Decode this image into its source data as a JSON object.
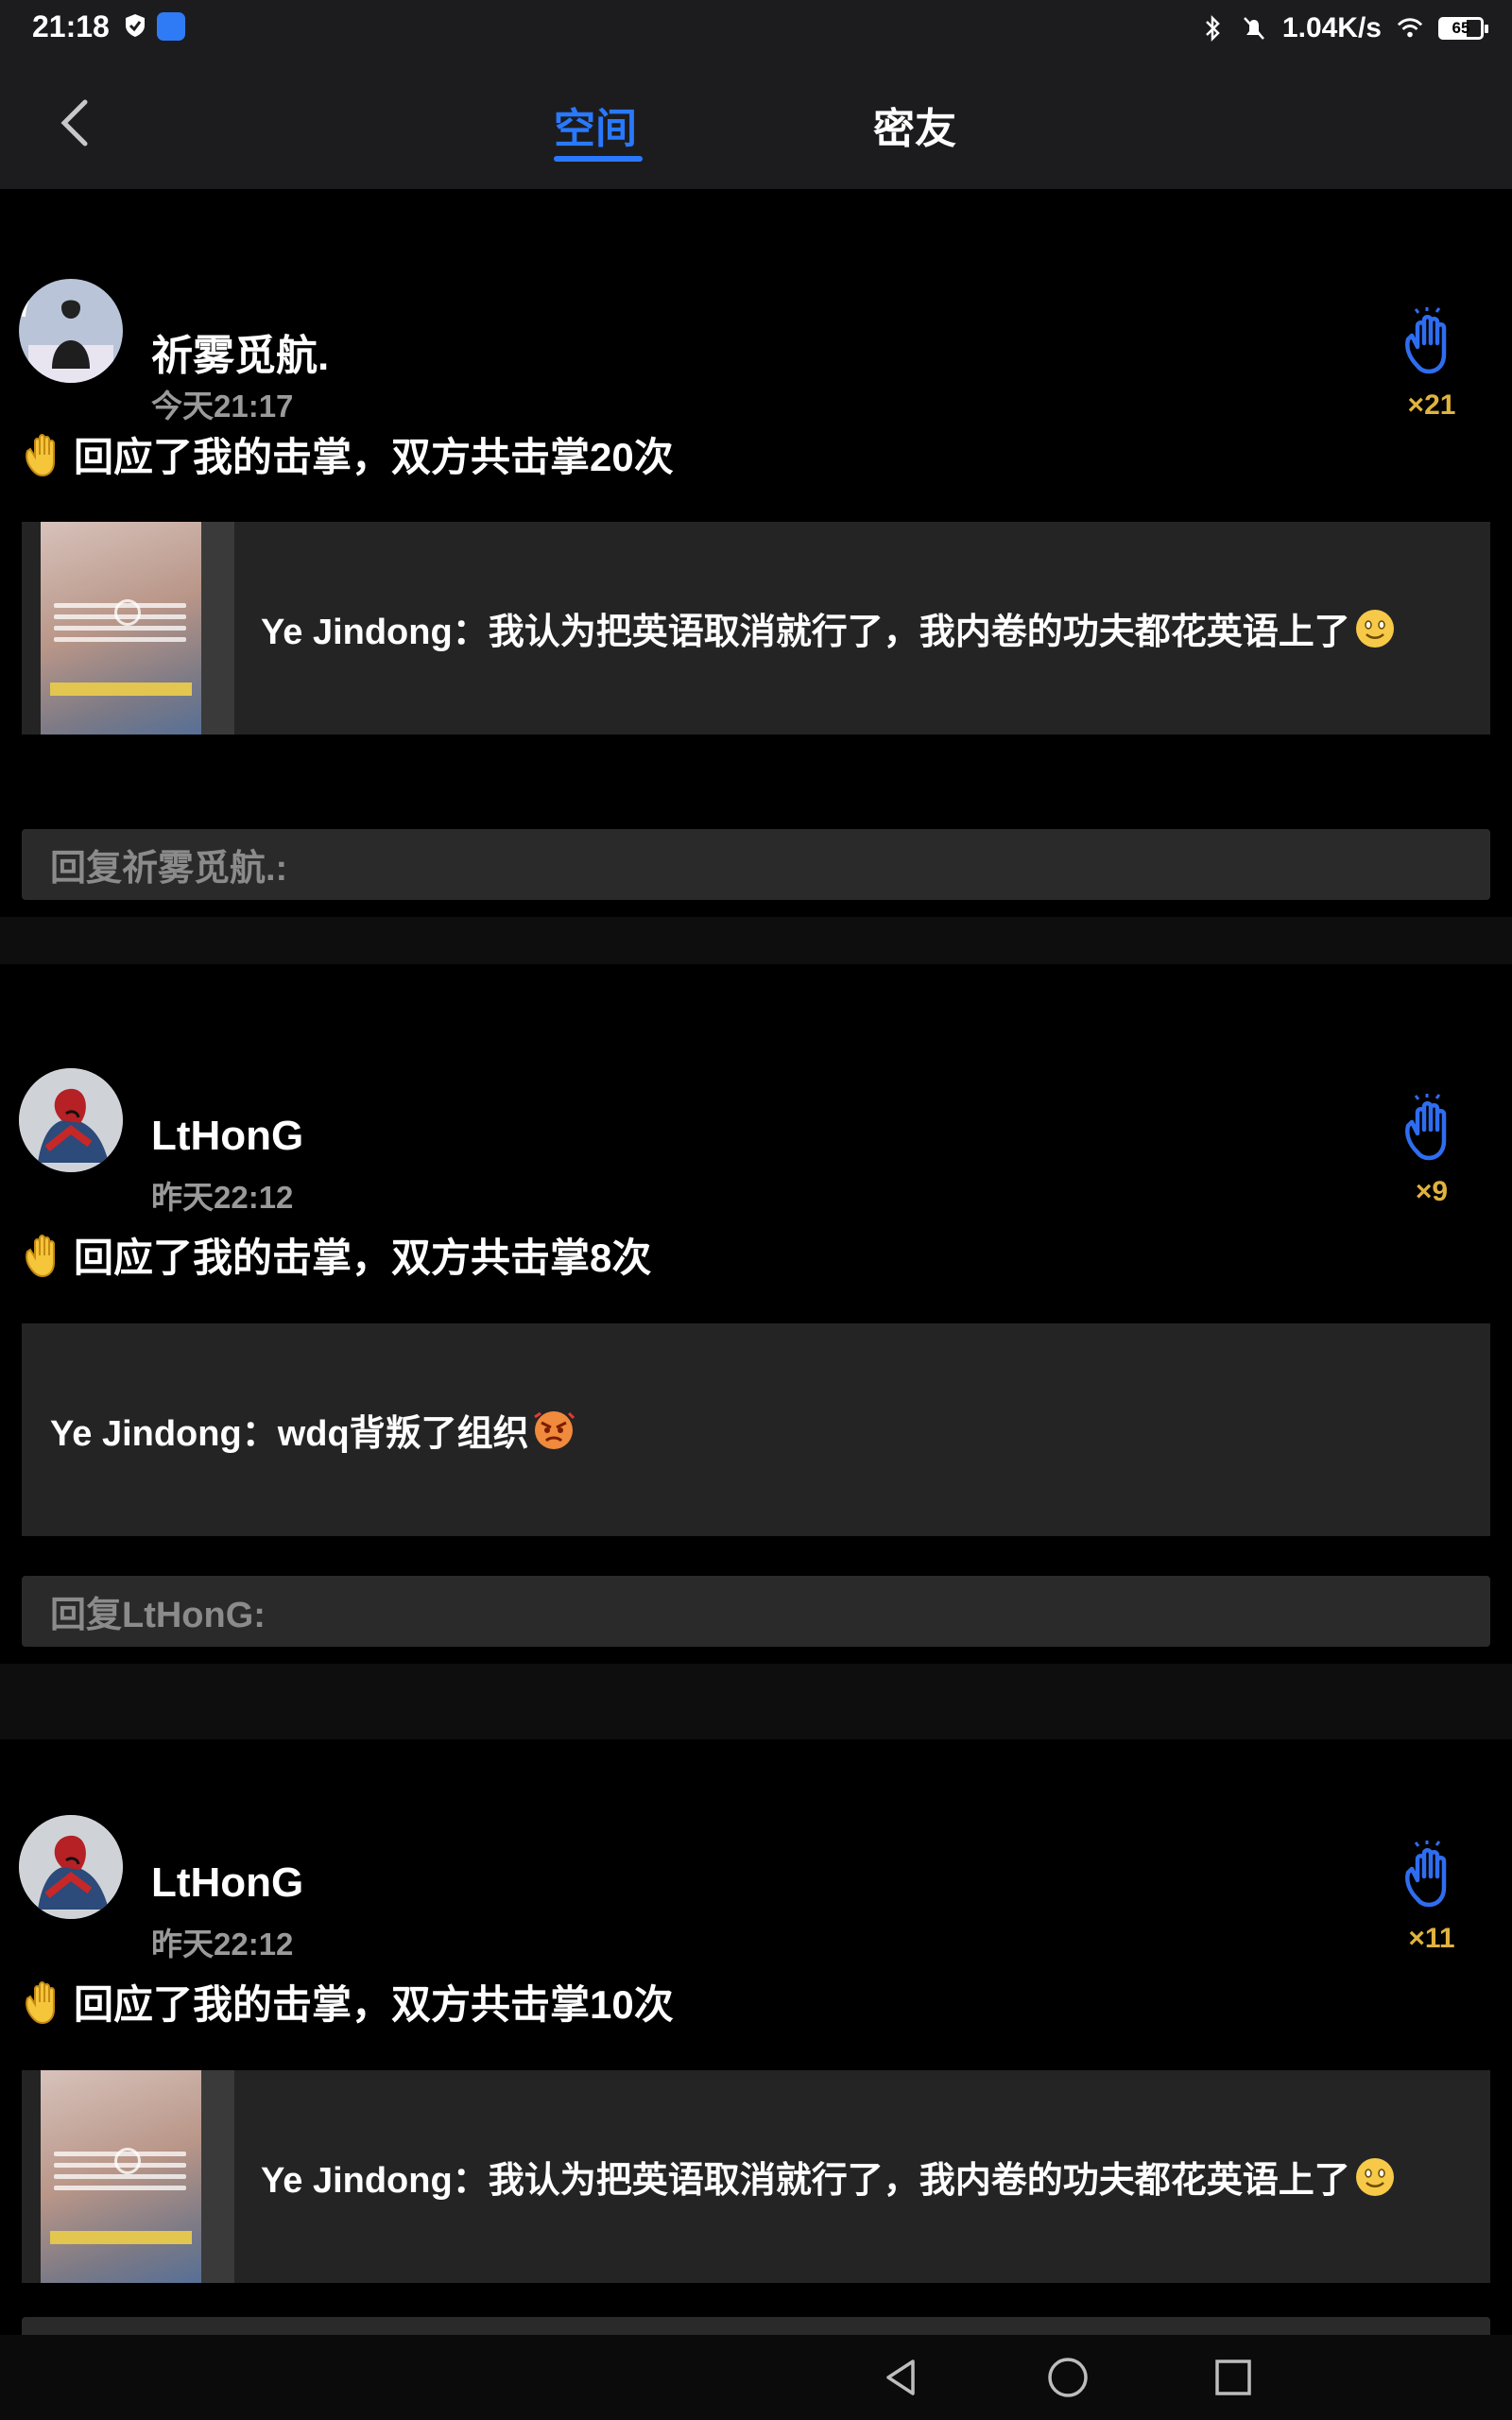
{
  "status_bar": {
    "time": "21:18",
    "speed": "1.04K/s",
    "battery": "65",
    "battery_level": 0.65
  },
  "nav": {
    "tabs": [
      "空间",
      "密友"
    ],
    "active_tab": "空间"
  },
  "posts": [
    {
      "user": "祈雾觅航.",
      "time": "今天21:17",
      "clap_count": "×21",
      "activity": "回应了我的击掌，双方共击掌20次",
      "quote": "Ye Jindong：我认为把英语取消就行了，我内卷的功夫都花英语上了",
      "quote_emoji": "smiling-face-emoji",
      "has_thumbnail": true,
      "reply_placeholder": "回复祈雾觅航.:"
    },
    {
      "user": "LtHonG",
      "time": "昨天22:12",
      "clap_count": "×9",
      "activity": "回应了我的击掌，双方共击掌8次",
      "quote": "Ye Jindong：wdq背叛了组织",
      "quote_emoji": "angry-face-emoji",
      "has_thumbnail": false,
      "reply_placeholder": "回复LtHonG:"
    },
    {
      "user": "LtHonG",
      "time": "昨天22:12",
      "clap_count": "×11",
      "activity": "回应了我的击掌，双方共击掌10次",
      "quote": "Ye Jindong：我认为把英语取消就行了，我内卷的功夫都花英语上了",
      "quote_emoji": "smiling-face-emoji",
      "has_thumbnail": true,
      "reply_placeholder": ""
    }
  ],
  "colors": {
    "accent": "#2979ff",
    "clap_icon": "#2f6df0",
    "clap_count": "#e0b33e",
    "background": "#000000",
    "panel": "#242424"
  }
}
